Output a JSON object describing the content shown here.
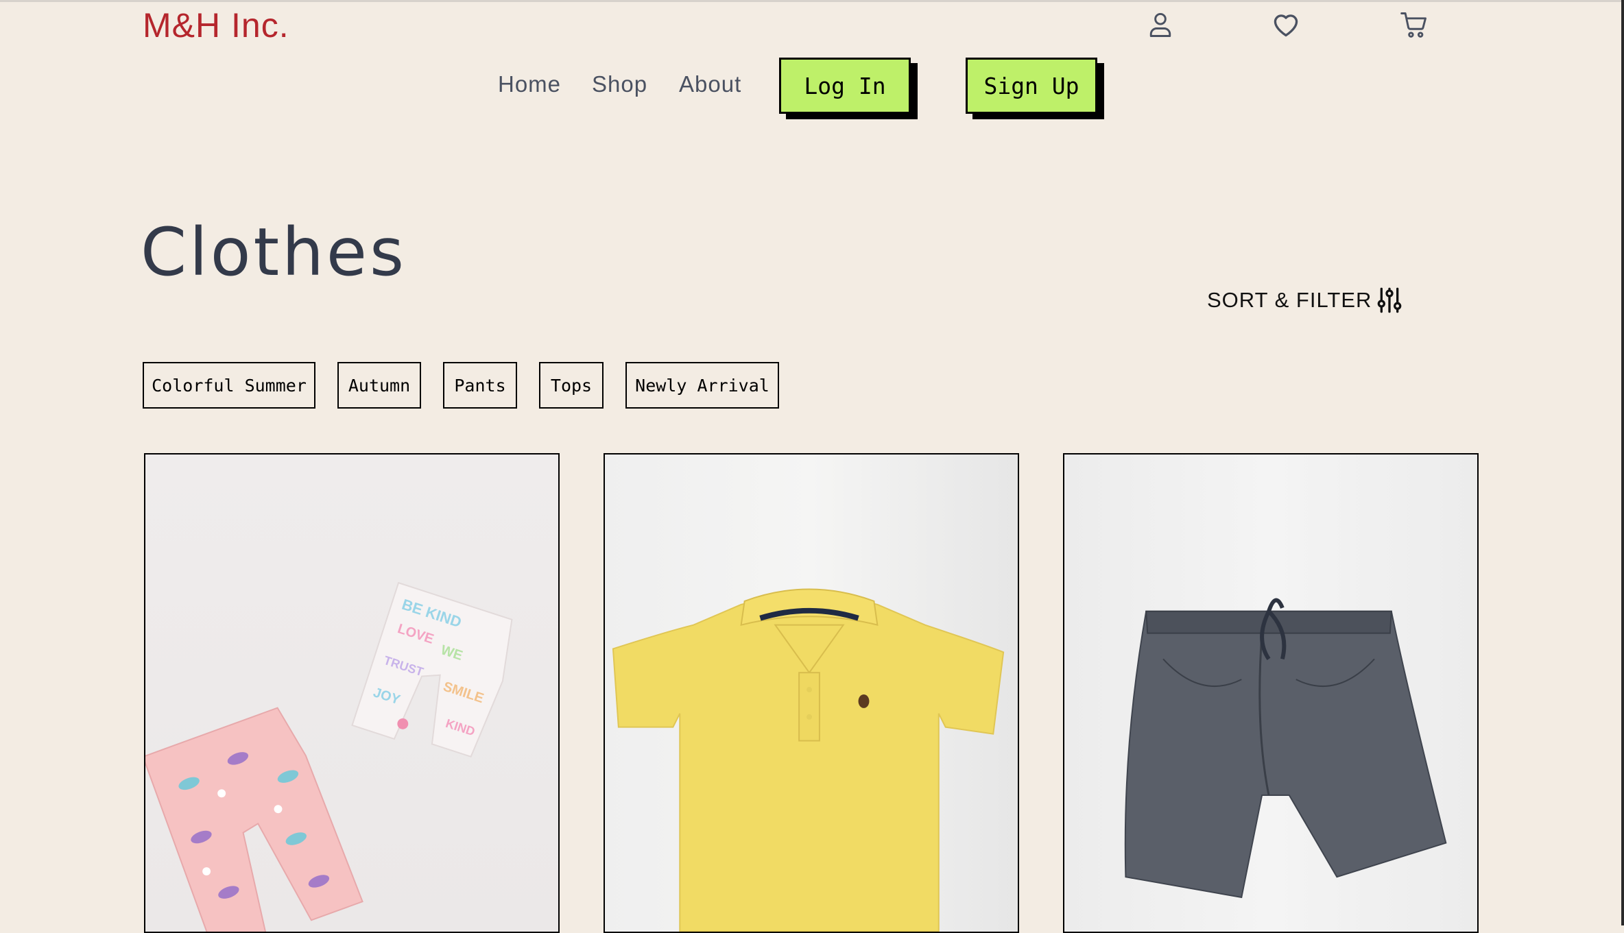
{
  "brand": {
    "name": "M&H Inc.",
    "color": "#b5262d"
  },
  "header": {
    "icons": [
      "user-icon",
      "heart-icon",
      "cart-icon"
    ],
    "nav": [
      {
        "label": "Home"
      },
      {
        "label": "Shop"
      },
      {
        "label": "About"
      }
    ],
    "login_label": "Log In",
    "signup_label": "Sign Up",
    "button_color": "#bef069"
  },
  "page": {
    "title": "Clothes",
    "sort_filter_label": "SORT & FILTER",
    "sort_filter_icon": "sliders-icon"
  },
  "categories": [
    {
      "label": "Colorful Summer"
    },
    {
      "label": "Autumn"
    },
    {
      "label": "Pants"
    },
    {
      "label": "Tops"
    },
    {
      "label": "Newly Arrival"
    }
  ],
  "products": [
    {
      "image": "pink-and-white-printed-shorts"
    },
    {
      "image": "yellow-polo-shirt"
    },
    {
      "image": "grey-chambray-shorts"
    }
  ],
  "colors": {
    "background": "#f3ece3",
    "title": "#333a4a",
    "nav": "#4a5161"
  }
}
